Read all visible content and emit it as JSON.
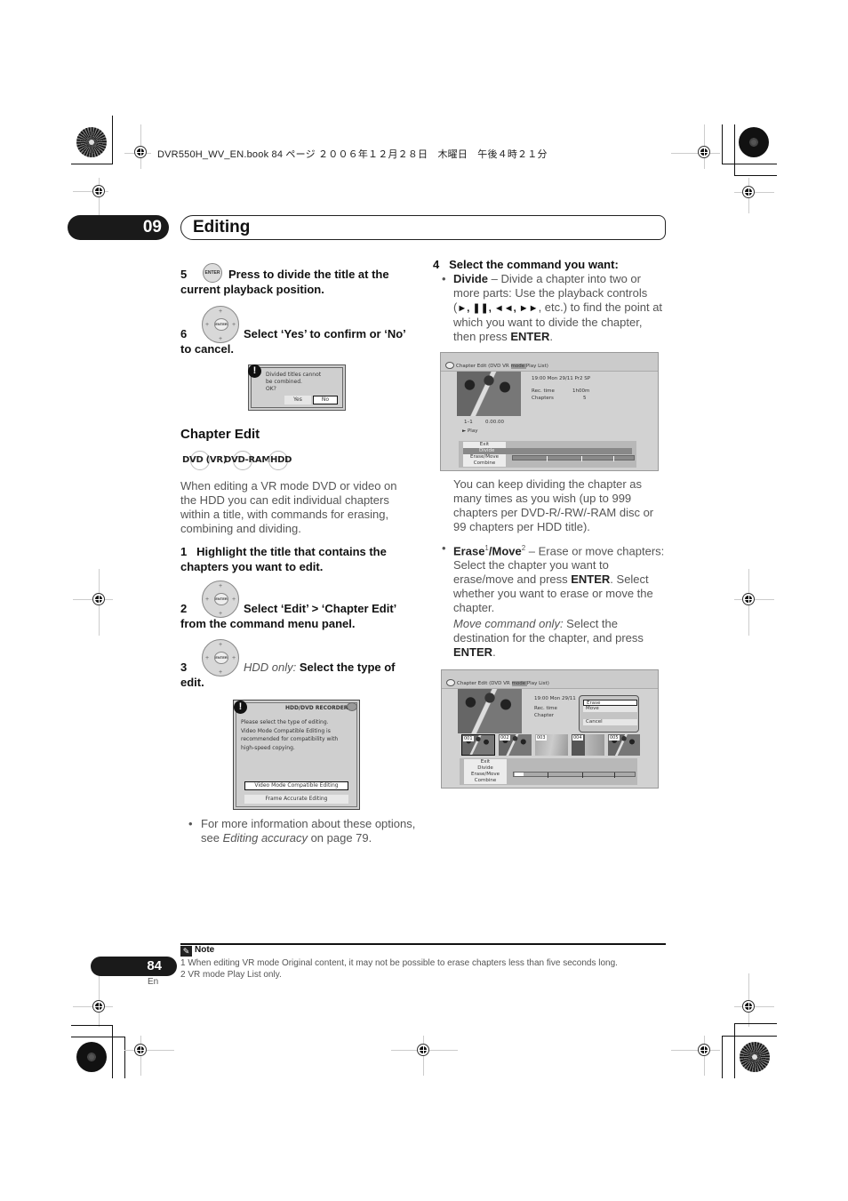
{
  "print_header": "DVR550H_WV_EN.book  84 ページ  ２００６年１２月２８日　木曜日　午後４時２１分",
  "chapter": {
    "number": "09",
    "title": "Editing"
  },
  "left_column": {
    "step5": {
      "num": "5",
      "button": "ENTER",
      "text": "Press to divide the title at the current playback position."
    },
    "step6": {
      "num": "6",
      "button": "ENTER",
      "text": "Select ‘Yes’ to confirm or ‘No’ to cancel."
    },
    "dialog_divide": {
      "icon": "!",
      "lines": [
        "Divided titles cannot",
        "be combined.",
        "OK?"
      ],
      "yes_label": "Yes",
      "no_label": "No",
      "selected": "No"
    },
    "section_heading": "Chapter Edit",
    "badges": [
      "DVD (VR)",
      "DVD-RAM",
      "HDD"
    ],
    "intro": "When editing a VR mode DVD or video on the HDD you can edit individual chapters within a title, with commands for erasing, combining and dividing.",
    "step1": {
      "num": "1",
      "text": "Highlight the title that contains the chapters you want to edit."
    },
    "step2": {
      "num": "2",
      "button": "ENTER",
      "text": "Select ‘Edit’ > ‘Chapter Edit’ from the command menu panel."
    },
    "step3": {
      "num": "3",
      "button": "ENTER",
      "prefix": "HDD only:",
      "text": "Select the type of edit."
    },
    "dialog_type": {
      "icon": "!",
      "header": "HDD/DVD RECORDER",
      "lines": [
        "Please select the type of editing.",
        "Video Mode Compatible Editing is",
        "recommended for compatibility with",
        "high-speed copying."
      ],
      "option1": "Video Mode Compatible Editing",
      "option2": "Frame Accurate Editing",
      "selected": "Video Mode Compatible Editing"
    },
    "bullet_info": {
      "pre": "For more information about these options, see ",
      "link": "Editing accuracy",
      "post": " on page 79."
    }
  },
  "right_column": {
    "step4": {
      "num": "4",
      "text": "Select the command you want:"
    },
    "divide_bullet": {
      "term": "Divide",
      "text1": " – Divide a chapter into two or more parts: Use the playback controls (",
      "controls": "►, ❚❚, ◄◄, ►►",
      "text2": ", etc.) to find the point at which you want to divide the chapter, then press ",
      "enter": "ENTER",
      "end": "."
    },
    "screen1": {
      "title_pre": "Chapter Edit (DVD VR ",
      "title_hl": "mode ",
      "title_post": "Play List)",
      "info_line": "19:00  Mon   29/11  Pr2   SP",
      "rec_time_label": "Rec. time",
      "rec_time_value": "1h00m",
      "chapters_label": "Chapters",
      "chapters_value": "5",
      "position": "1–1",
      "timecode": "0.00.00",
      "play_label": "► Play",
      "menu": [
        "Exit",
        "Divide",
        "Erase/Move",
        "Combine"
      ],
      "selected": "Divide"
    },
    "divide_followup": "You can keep dividing the chapter as many times as you wish (up to 999 chapters per DVD-R/-RW/-RAM disc or 99 chapters per HDD title).",
    "erase_bullet": {
      "term1": "Erase",
      "sup1": "1",
      "sep": "/",
      "term2": "Move",
      "sup2": "2",
      "text1": " – Erase or move chapters: Select the chapter you want to erase/move and press ",
      "enter": "ENTER",
      "text2": ". Select whether you want to erase or move the chapter."
    },
    "move_note": {
      "italic": "Move command only:",
      "text": " Select the destination for the chapter, and press ",
      "enter": "ENTER",
      "end": "."
    },
    "screen2": {
      "title_pre": "Chapter Edit (DVD VR ",
      "title_hl": "mode ",
      "title_post": "Play List)",
      "info_line": "19:00  Mon   29/11",
      "rec_time_label": "Rec. time",
      "chapter_label": "Chapter",
      "popup": [
        "Erase",
        "Move",
        "Cancel"
      ],
      "popup_selected": "Erase",
      "thumbs": [
        "001",
        "002",
        "003",
        "004",
        "005"
      ],
      "menu": [
        "Exit",
        "Divide",
        "Erase/Move",
        "Combine"
      ],
      "selected": "Erase/Move"
    }
  },
  "note": {
    "title": "Note",
    "items": [
      "1 When editing VR mode Original content, it may not be possible to erase chapters less than five seconds long.",
      "2 VR mode Play List only."
    ]
  },
  "footer": {
    "page_number": "84",
    "language": "En"
  }
}
